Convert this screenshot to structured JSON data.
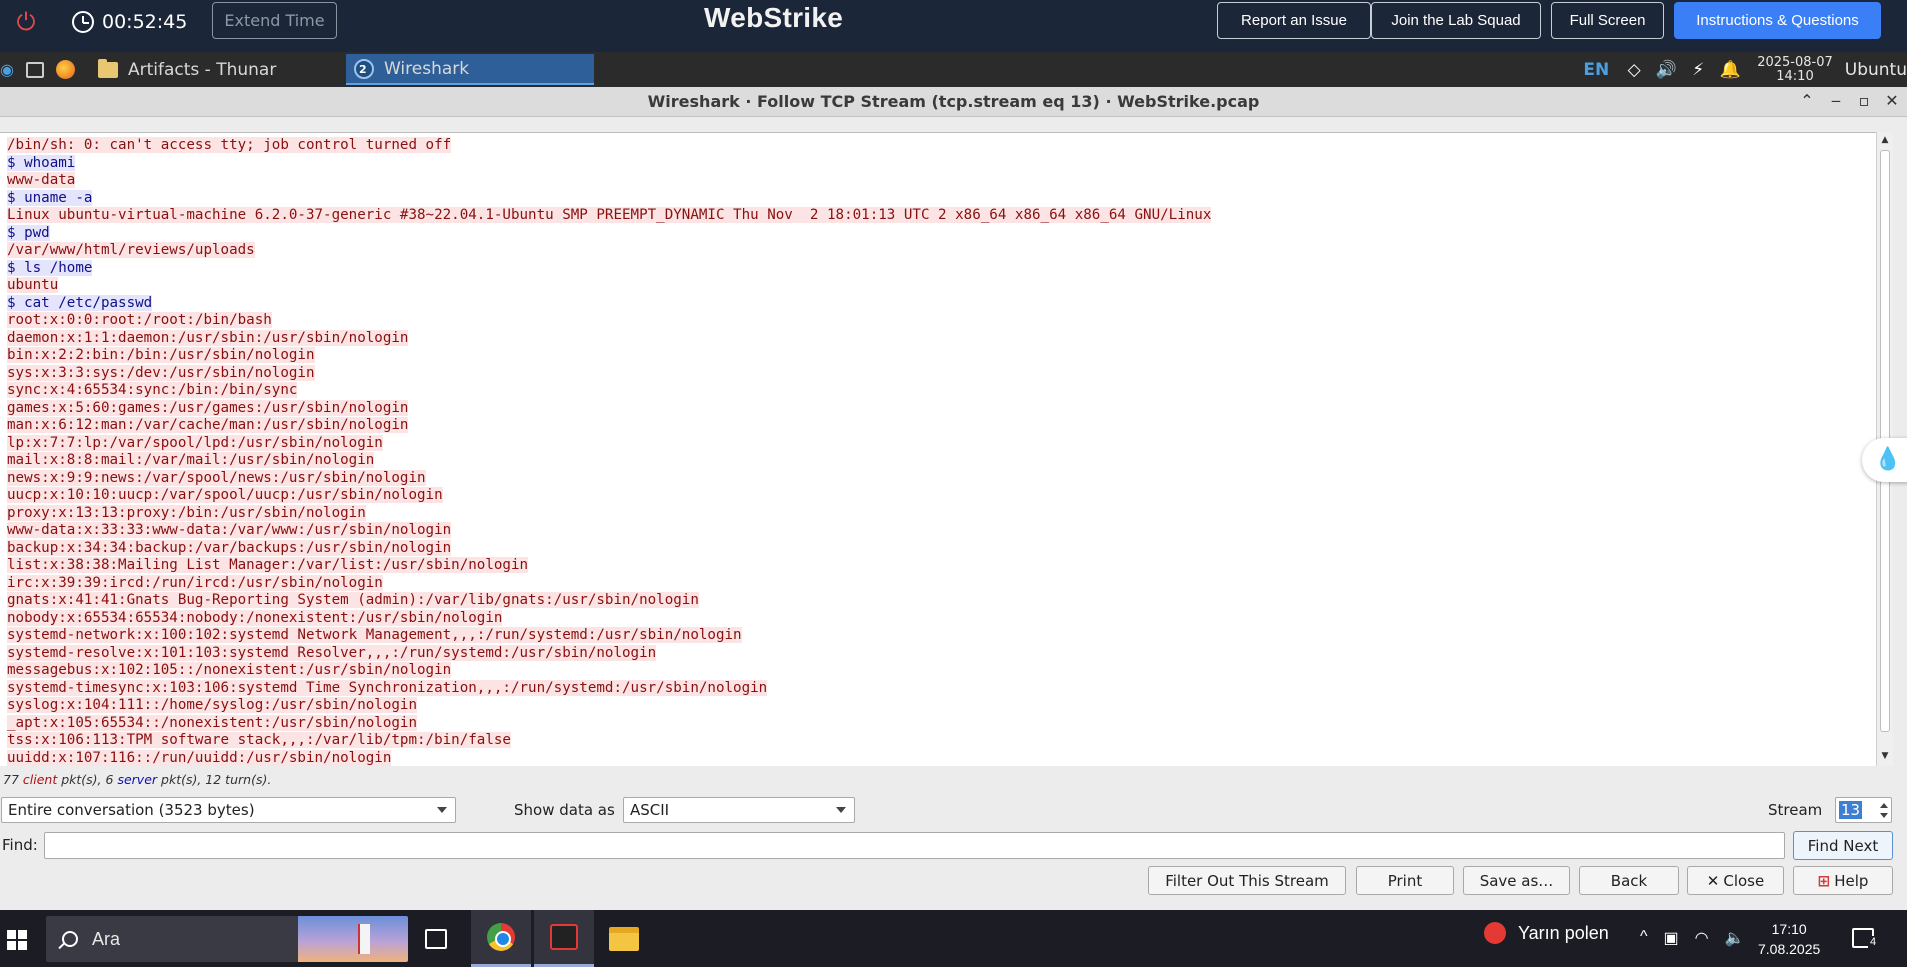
{
  "labbar": {
    "timer": "00:52:45",
    "extend_label": "Extend Time",
    "brand": "WebStrike",
    "buttons": [
      "Report an Issue",
      "Join the Lab Squad",
      "Full Screen",
      "Instructions & Questions"
    ]
  },
  "panel": {
    "tasks": [
      {
        "label": "Artifacts - Thunar",
        "active": false
      },
      {
        "label": "Wireshark",
        "active": true,
        "badge": "2"
      }
    ],
    "lang": "EN",
    "date": "2025-08-07",
    "time": "14:10",
    "user": "Ubuntu"
  },
  "window": {
    "title": "Wireshark · Follow TCP Stream (tcp.stream eq 13) · WebStrike.pcap"
  },
  "stream": {
    "lines": [
      {
        "t": "c",
        "text": "/bin/sh: 0: can't access tty; job control turned off"
      },
      {
        "t": "s",
        "text": "$ whoami"
      },
      {
        "t": "c",
        "text": "www-data"
      },
      {
        "t": "s",
        "text": "$ uname -a"
      },
      {
        "t": "c",
        "text": "Linux ubuntu-virtual-machine 6.2.0-37-generic #38~22.04.1-Ubuntu SMP PREEMPT_DYNAMIC Thu Nov  2 18:01:13 UTC 2 x86_64 x86_64 x86_64 GNU/Linux"
      },
      {
        "t": "s",
        "text": "$ pwd"
      },
      {
        "t": "c",
        "text": "/var/www/html/reviews/uploads"
      },
      {
        "t": "s",
        "text": "$ ls /home"
      },
      {
        "t": "c",
        "text": "ubuntu"
      },
      {
        "t": "s",
        "text": "$ cat /etc/passwd"
      },
      {
        "t": "c",
        "text": "root:x:0:0:root:/root:/bin/bash"
      },
      {
        "t": "c",
        "text": "daemon:x:1:1:daemon:/usr/sbin:/usr/sbin/nologin"
      },
      {
        "t": "c",
        "text": "bin:x:2:2:bin:/bin:/usr/sbin/nologin"
      },
      {
        "t": "c",
        "text": "sys:x:3:3:sys:/dev:/usr/sbin/nologin"
      },
      {
        "t": "c",
        "text": "sync:x:4:65534:sync:/bin:/bin/sync"
      },
      {
        "t": "c",
        "text": "games:x:5:60:games:/usr/games:/usr/sbin/nologin"
      },
      {
        "t": "c",
        "text": "man:x:6:12:man:/var/cache/man:/usr/sbin/nologin"
      },
      {
        "t": "c",
        "text": "lp:x:7:7:lp:/var/spool/lpd:/usr/sbin/nologin"
      },
      {
        "t": "c",
        "text": "mail:x:8:8:mail:/var/mail:/usr/sbin/nologin"
      },
      {
        "t": "c",
        "text": "news:x:9:9:news:/var/spool/news:/usr/sbin/nologin"
      },
      {
        "t": "c",
        "text": "uucp:x:10:10:uucp:/var/spool/uucp:/usr/sbin/nologin"
      },
      {
        "t": "c",
        "text": "proxy:x:13:13:proxy:/bin:/usr/sbin/nologin"
      },
      {
        "t": "c",
        "text": "www-data:x:33:33:www-data:/var/www:/usr/sbin/nologin"
      },
      {
        "t": "c",
        "text": "backup:x:34:34:backup:/var/backups:/usr/sbin/nologin"
      },
      {
        "t": "c",
        "text": "list:x:38:38:Mailing List Manager:/var/list:/usr/sbin/nologin"
      },
      {
        "t": "c",
        "text": "irc:x:39:39:ircd:/run/ircd:/usr/sbin/nologin"
      },
      {
        "t": "c",
        "text": "gnats:x:41:41:Gnats Bug-Reporting System (admin):/var/lib/gnats:/usr/sbin/nologin"
      },
      {
        "t": "c",
        "text": "nobody:x:65534:65534:nobody:/nonexistent:/usr/sbin/nologin"
      },
      {
        "t": "c",
        "text": "systemd-network:x:100:102:systemd Network Management,,,:/run/systemd:/usr/sbin/nologin"
      },
      {
        "t": "c",
        "text": "systemd-resolve:x:101:103:systemd Resolver,,,:/run/systemd:/usr/sbin/nologin"
      },
      {
        "t": "c",
        "text": "messagebus:x:102:105::/nonexistent:/usr/sbin/nologin"
      },
      {
        "t": "c",
        "text": "systemd-timesync:x:103:106:systemd Time Synchronization,,,:/run/systemd:/usr/sbin/nologin"
      },
      {
        "t": "c",
        "text": "syslog:x:104:111::/home/syslog:/usr/sbin/nologin"
      },
      {
        "t": "c",
        "text": "_apt:x:105:65534::/nonexistent:/usr/sbin/nologin"
      },
      {
        "t": "c",
        "text": "tss:x:106:113:TPM software stack,,,:/var/lib/tpm:/bin/false"
      },
      {
        "t": "c",
        "text": "uuidd:x:107:116::/run/uuidd:/usr/sbin/nologin"
      }
    ]
  },
  "stats": {
    "client_count": "77",
    "client_word": "client",
    "mid": "pkt(s), 6",
    "server_word": "server",
    "tail": "pkt(s), 12 turn(s)."
  },
  "controls": {
    "conversation_value": "Entire conversation (3523 bytes)",
    "show_data_label": "Show data as",
    "show_data_value": "ASCII",
    "stream_label": "Stream",
    "stream_value": "13",
    "find_label": "Find:",
    "find_value": "",
    "find_next_label": "Find Next",
    "buttons": [
      "Filter Out This Stream",
      "Print",
      "Save as…",
      "Back",
      "Close",
      "Help"
    ]
  },
  "colors": {
    "client_fg": "#8a1010",
    "client_bg": "#fce4e4",
    "server_fg": "#10108a",
    "server_bg": "#e4e4fc",
    "accent": "#3a7ff6"
  },
  "taskbar": {
    "search_placeholder": "Ara",
    "weather": "Yarın polen",
    "time": "17:10",
    "date": "7.08.2025",
    "notif_count": "4"
  }
}
